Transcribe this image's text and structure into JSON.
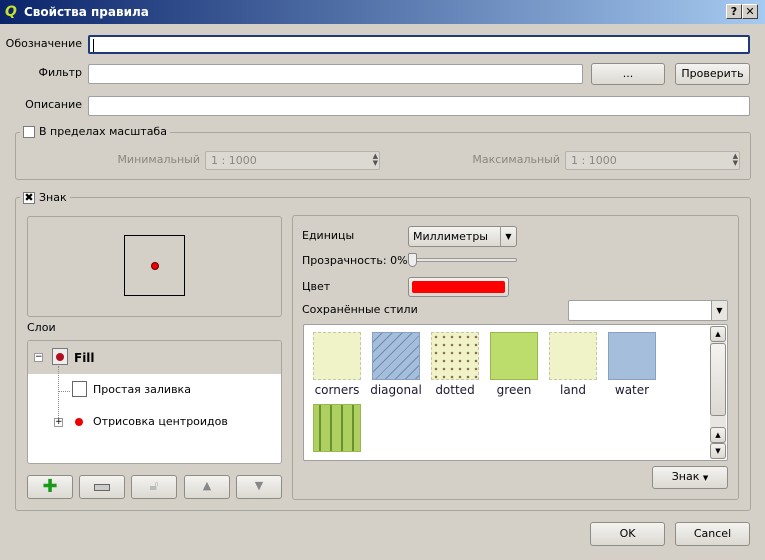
{
  "window": {
    "title": "Свойства правила",
    "help_label": "?",
    "close_label": "✕"
  },
  "form": {
    "label_label": "Обозначение",
    "label_value": "",
    "filter_label": "Фильтр",
    "filter_value": "",
    "filter_browse": "...",
    "filter_test": "Проверить",
    "description_label": "Описание",
    "description_value": ""
  },
  "scale": {
    "checkbox_label": "В пределах масштаба",
    "checked": false,
    "min_label": "Минимальный",
    "min_value": "1 : 1000",
    "max_label": "Максимальный",
    "max_value": "1 : 1000"
  },
  "symbol": {
    "checkbox_label": "Знак",
    "checked": true,
    "layers_label": "Слои",
    "tree": [
      {
        "label": "Fill"
      },
      {
        "label": "Простая заливка"
      },
      {
        "label": "Отрисовка центроидов"
      }
    ],
    "units_label": "Единицы",
    "units_value": "Миллиметры",
    "transparency_label": "Прозрачность: 0%",
    "transparency": 0,
    "color_label": "Цвет",
    "color": "#ff0000",
    "saved_styles_label": "Сохранённые стили",
    "saved_styles_value": "",
    "styles": [
      {
        "name": "corners",
        "color": "#f0f2c8"
      },
      {
        "name": "diagonal",
        "color": "#a4bedc"
      },
      {
        "name": "dotted",
        "color": "#f0f2c8"
      },
      {
        "name": "green",
        "color": "#bcdc6c"
      },
      {
        "name": "land",
        "color": "#f0f2c8"
      },
      {
        "name": "water",
        "color": "#a4bedc"
      },
      {
        "name": "",
        "color": "#aed060"
      }
    ],
    "symbol_button": "Знак"
  },
  "footer": {
    "ok": "OK",
    "cancel": "Cancel"
  }
}
